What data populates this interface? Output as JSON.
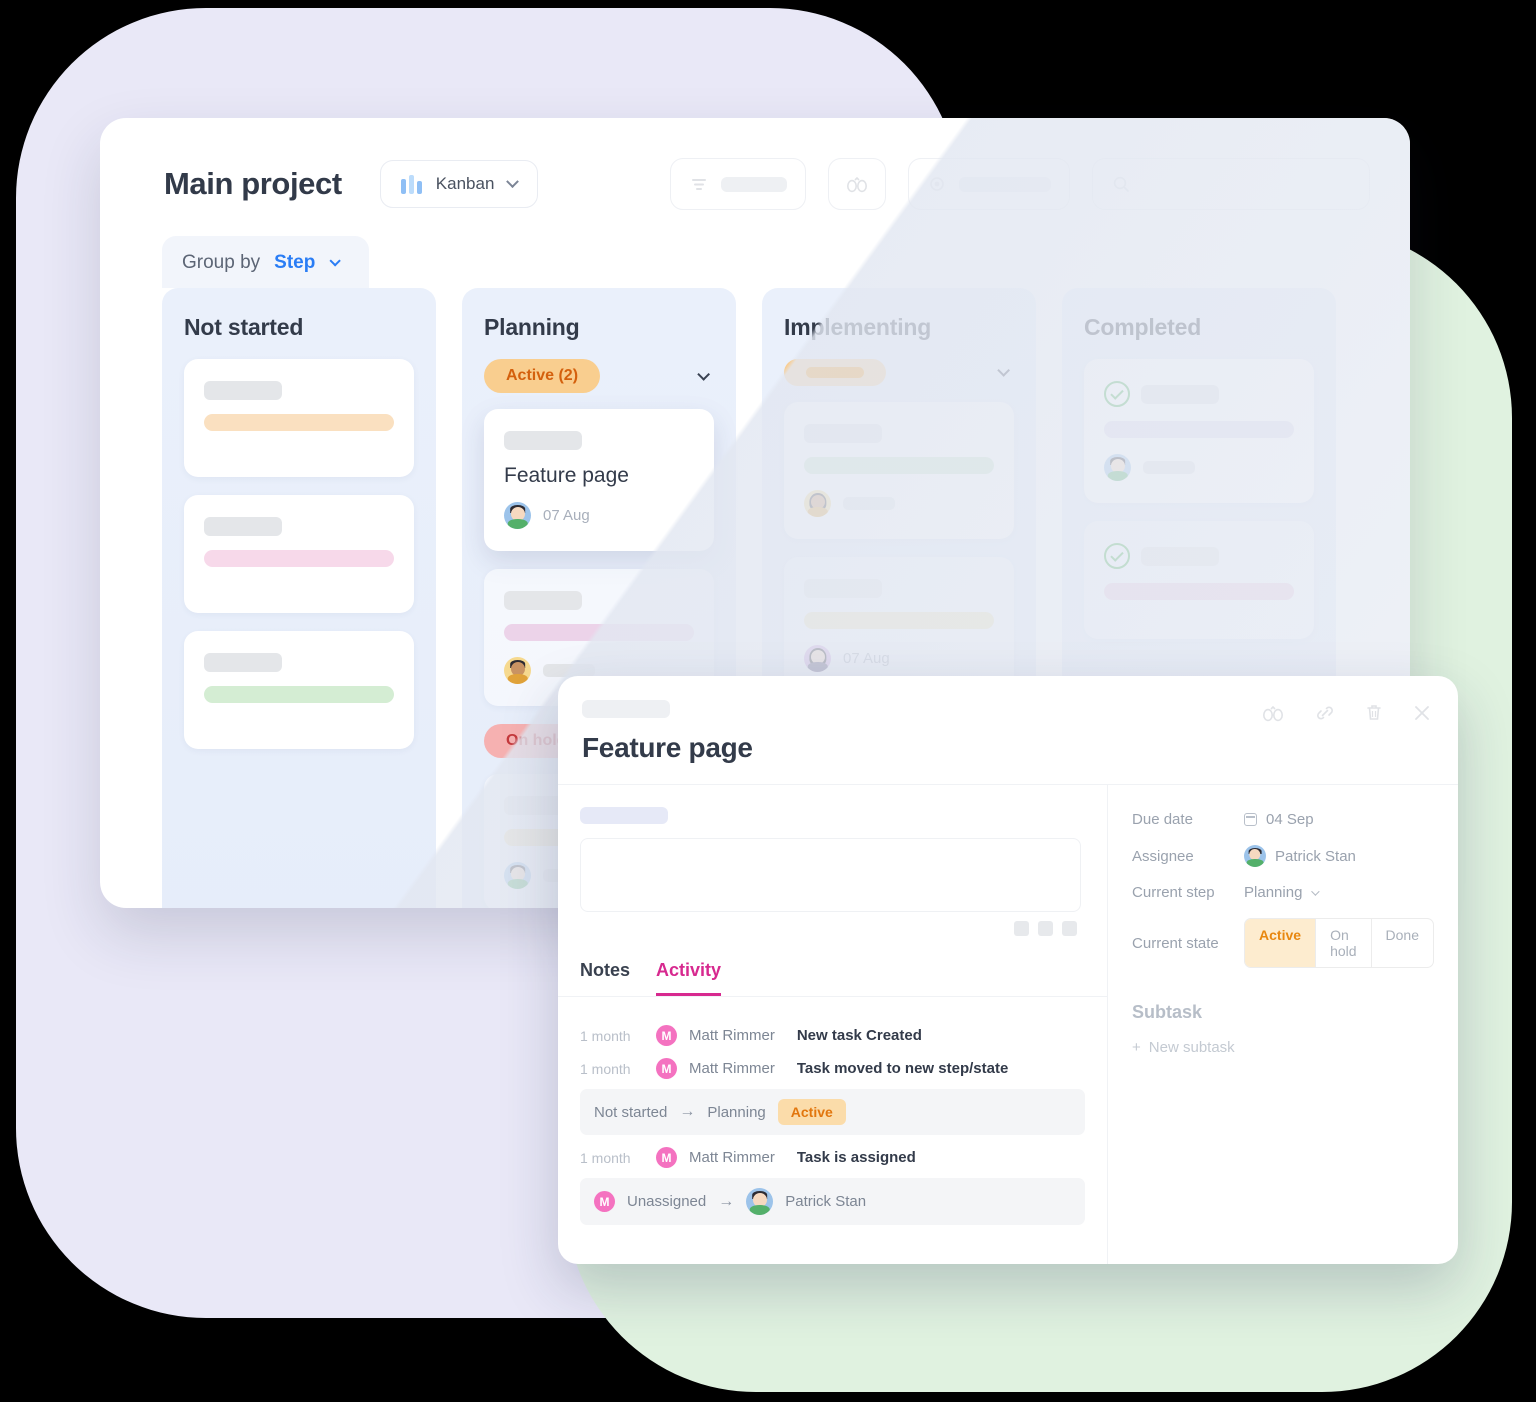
{
  "header": {
    "project_title": "Main project",
    "view_label": "Kanban",
    "view_icon": "kanban-icon",
    "filter_icon": "filter-icon",
    "watch_icon": "binoculars-icon",
    "visibility_icon": "eye-icon",
    "search_icon": "search-icon",
    "search_value": ""
  },
  "groupby": {
    "label": "Group by",
    "value": "Step"
  },
  "board": {
    "columns": [
      {
        "title": "Not started",
        "status_badge": null,
        "cards": [
          {
            "bar_color": "#fae0c0",
            "has_avatar": false,
            "skeleton": true
          },
          {
            "bar_color": "#f7d9ea",
            "has_avatar": false,
            "skeleton": true
          },
          {
            "bar_color": "#d4edd3",
            "has_avatar": false,
            "skeleton": true
          }
        ]
      },
      {
        "title": "Planning",
        "status_badge": {
          "label": "Active (2)",
          "style": "active"
        },
        "cards": [
          {
            "name": "Feature page",
            "date": "07 Aug",
            "avatar": "blue-male",
            "skeleton": false
          },
          {
            "bar_color": "#ecd3e9",
            "has_avatar": true,
            "avatar": "cream-male",
            "skeleton": true
          }
        ],
        "status_badge_2": {
          "label": "On hold",
          "style": "hold"
        },
        "cards_2": [
          {
            "bar_color": "#efe2bd",
            "has_avatar": true,
            "avatar": "blue-male",
            "skeleton": true
          }
        ]
      },
      {
        "title": "Implementing",
        "status_badge": {
          "label": "",
          "style": "skeleton"
        },
        "cards": [
          {
            "bar_color": "#cfe9cf",
            "has_avatar": true,
            "avatar": "violet-female",
            "skeleton": true
          },
          {
            "bar_color": "#eee3bd",
            "has_avatar": true,
            "avatar": "violet-female",
            "date": "07 Aug",
            "skeleton": true
          }
        ]
      },
      {
        "title": "Completed",
        "status_badge": null,
        "cards": [
          {
            "bar_color": "#e3dff2",
            "has_avatar": true,
            "avatar": "blue-male",
            "checked": true,
            "skeleton": true
          },
          {
            "bar_color": "#ebcfe4",
            "has_avatar": false,
            "checked": true,
            "skeleton": true
          }
        ]
      }
    ]
  },
  "modal": {
    "chip": "",
    "title": "Feature page",
    "actions": {
      "watch_icon": "binoculars-icon",
      "link_icon": "link-icon",
      "delete_icon": "trash-icon",
      "close_icon": "close-icon"
    },
    "description_label": "",
    "description_value": "",
    "tabs": [
      {
        "label": "Notes",
        "active": false
      },
      {
        "label": "Activity",
        "active": true
      }
    ],
    "activity": [
      {
        "time": "1 month",
        "avatar_letter": "M",
        "user": "Matt Rimmer",
        "text": "New task Created",
        "detail": null
      },
      {
        "time": "1 month",
        "avatar_letter": "M",
        "user": "Matt Rimmer",
        "text": "Task moved to new step/state",
        "detail": {
          "from": "Not started",
          "arrow": "→",
          "to": "Planning",
          "badge": "Active"
        }
      },
      {
        "time": "1 month",
        "avatar_letter": "M",
        "user": "Matt Rimmer",
        "text": "Task is assigned",
        "detail": {
          "from": "Unassigned",
          "arrow": "→",
          "to": "Patrick Stan",
          "badge": null
        }
      }
    ],
    "fields": [
      {
        "label": "Due date",
        "value": "04 Sep",
        "icon": "calendar-icon"
      },
      {
        "label": "Assignee",
        "value": "Patrick Stan",
        "icon": "avatar"
      },
      {
        "label": "Current step",
        "value": "Planning",
        "icon": "chevron-down-icon"
      },
      {
        "label": "Current state",
        "value": "Active",
        "icon": "segmented"
      }
    ],
    "state_options": [
      "Active",
      "On hold",
      "Done"
    ],
    "subtask_heading": "Subtask",
    "new_subtask_label": "New subtask",
    "new_subtask_plus": "+"
  },
  "colors": {
    "accent_blue": "#2a7df5",
    "accent_pink": "#d7298f",
    "active_orange": "#e2760d",
    "hold_red": "#c5393c",
    "done_green": "#4fb35b",
    "bg_lavender": "#e9e8f7",
    "bg_green": "#e0f2e0"
  }
}
